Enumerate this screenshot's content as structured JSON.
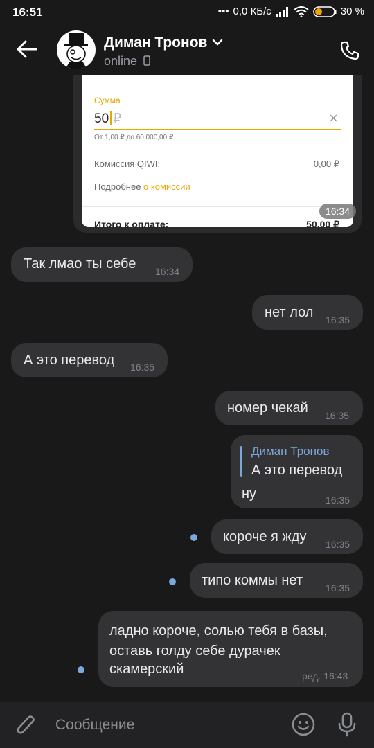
{
  "status": {
    "time": "16:51",
    "net": "0,0 КБ/с",
    "battery": "30 %"
  },
  "chat": {
    "name": "Диман Тронов",
    "status": "online"
  },
  "image": {
    "sum_label": "Сумма",
    "amount": "50",
    "currency": "₽",
    "range": "От 1,00 ₽ до 60 000,00 ₽",
    "fee_label": "Комиссия QIWI:",
    "fee_value": "0,00 ₽",
    "more_label": "Подробнее",
    "more_link": "о комиссии",
    "total_label": "Итого к оплате:",
    "total_value": "50,00 ₽",
    "time": "16:34"
  },
  "messages": [
    {
      "text": "Так лмао ты себе",
      "time": "16:34"
    },
    {
      "text": "нет лол",
      "time": "16:35"
    },
    {
      "text": "А это перевод",
      "time": "16:35"
    },
    {
      "text": "номер чекай",
      "time": "16:35"
    },
    {
      "reply_name": "Диман Тронов",
      "line1": "А это перевод",
      "line2": "ну",
      "time": "16:35"
    },
    {
      "text": "короче я жду",
      "time": "16:35"
    },
    {
      "text": "типо коммы нет",
      "time": "16:35"
    },
    {
      "line1": "ладно короче, солью тебя в базы,",
      "line2": "оставь голду себе дурачек",
      "line3": "скамерский",
      "time": "ред. 16:43"
    }
  ],
  "composer": {
    "placeholder": "Сообщение"
  },
  "colors": {
    "accent": "#7ba7da",
    "bubble": "#333335",
    "background": "#19191a",
    "qiwi": "#e8a700"
  }
}
